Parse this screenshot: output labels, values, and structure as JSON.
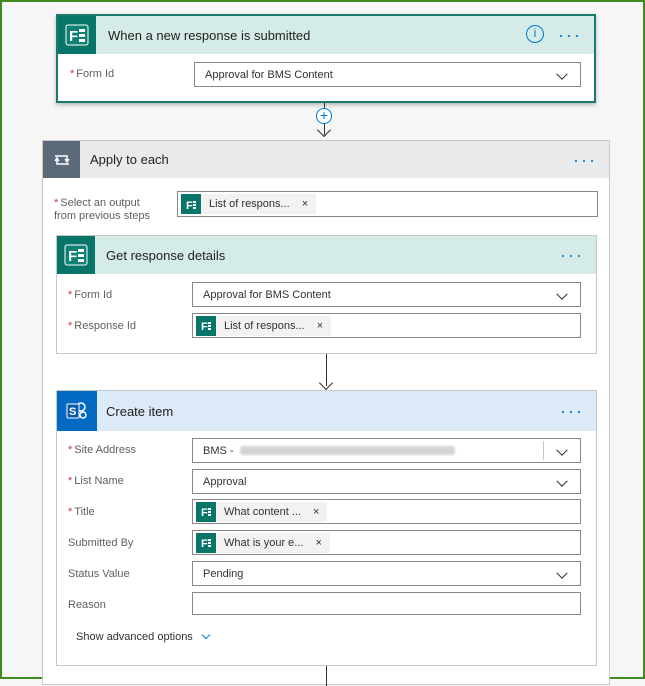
{
  "trigger": {
    "title": "When a new response is submitted",
    "form_id_label": "Form Id",
    "form_id_value": "Approval for BMS Content"
  },
  "apply_each": {
    "title": "Apply to each",
    "select_label_1": "Select an output",
    "select_label_2": "from previous steps",
    "token_text": "List of respons..."
  },
  "get_response": {
    "title": "Get response details",
    "form_id_label": "Form Id",
    "form_id_value": "Approval for BMS Content",
    "response_id_label": "Response Id",
    "response_token": "List of respons..."
  },
  "create_item": {
    "title": "Create item",
    "site_label": "Site Address",
    "site_value": "BMS -",
    "list_label": "List Name",
    "list_value": "Approval",
    "title_label": "Title",
    "title_token": "What content ...",
    "submitted_label": "Submitted By",
    "submitted_token": "What is your e...",
    "status_label": "Status Value",
    "status_value": "Pending",
    "reason_label": "Reason",
    "reason_value": "",
    "advanced": "Show advanced options"
  },
  "icons": {
    "forms": "forms-icon",
    "sharepoint": "sharepoint-icon",
    "loop": "loop-icon",
    "info": "info-icon",
    "more": "more-icon",
    "close": "close-icon",
    "chevron": "chevron-down-icon",
    "plus": "plus-icon"
  },
  "colors": {
    "forms": "#077568",
    "sharepoint": "#036ac4",
    "accent": "#0078d4",
    "frame": "#3f8a1e"
  }
}
